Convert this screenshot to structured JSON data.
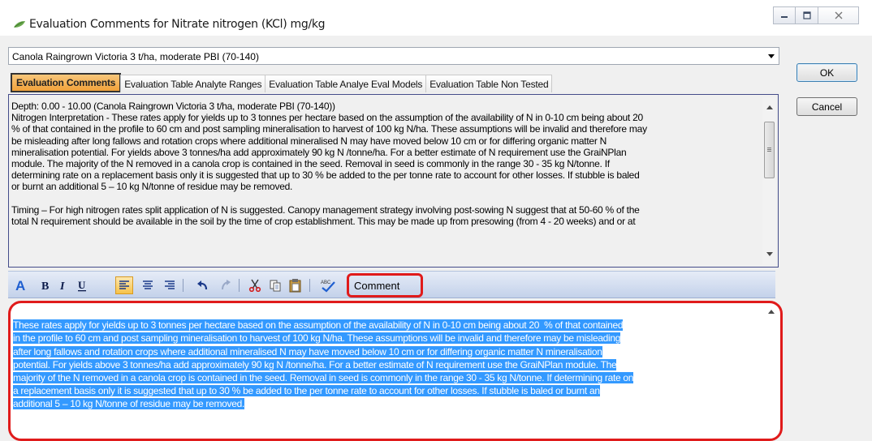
{
  "window": {
    "title": "Evaluation Comments for Nitrate nitrogen (KCl)  mg/kg",
    "icon": "plant-leaf-icon",
    "controls": {
      "minimize": "▭",
      "maximize": "▣",
      "close": "✕"
    }
  },
  "crop_select": {
    "value": "Canola Raingrown Victoria 3 t/ha, moderate PBI (70-140)"
  },
  "buttons": {
    "ok": "OK",
    "cancel": "Cancel"
  },
  "tabs": [
    {
      "label": "Evaluation Comments",
      "active": true
    },
    {
      "label": "Evaluation Table Analyte Ranges",
      "active": false
    },
    {
      "label": "Evaluation Table Analye Eval Models",
      "active": false
    },
    {
      "label": "Evaluation Table Non Tested",
      "active": false
    }
  ],
  "evaluation": {
    "text": "Depth: 0.00 - 10.00 (Canola Raingrown Victoria 3 t/ha, moderate PBI (70-140))\nNitrogen Interpretation - These rates apply for yields up to 3 tonnes per hectare based on the assumption of the availability of N in 0-10 cm being about 20\n% of that contained in the profile to 60 cm and post sampling mineralisation to harvest of 100 kg N/ha. These assumptions will be invalid and therefore may\nbe misleading after long fallows and rotation crops where additional mineralised N may have moved below 10 cm or for differing organic matter N\nmineralisation potential. For yields above 3 tonnes/ha add approximately 90 kg N /tonne/ha. For a better estimate of N requirement use the GraiNPlan\nmodule. The majority of the N removed in a canola crop is contained in the seed. Removal in seed is commonly in the range 30 - 35 kg N/tonne. If\ndetermining rate on a replacement basis only it is suggested that up to 30 % be added to the per tonne rate to account for other losses. If stubble is baled\nor burnt an additional 5 – 10 kg N/tonne of residue may be removed.\n\nTiming – For high nitrogen rates split application of N is suggested. Canopy management strategy involving post-sowing N suggest that at 50-60 % of the\ntotal N requirement should be available in the soil by the time of crop establishment. This may be made up from presowing (from 4 - 20 weeks) and or at"
  },
  "toolbar": {
    "items": [
      {
        "name": "font-color-icon",
        "glyph": "A"
      },
      {
        "name": "bold-icon",
        "glyph": "B"
      },
      {
        "name": "italic-icon",
        "glyph": "I"
      },
      {
        "name": "underline-icon",
        "glyph": "U"
      },
      {
        "name": "align-left-icon",
        "glyph": "≡"
      },
      {
        "name": "align-center-icon",
        "glyph": "≡"
      },
      {
        "name": "align-right-icon",
        "glyph": "≡"
      },
      {
        "name": "undo-icon",
        "glyph": "↶"
      },
      {
        "name": "redo-icon",
        "glyph": "↷"
      },
      {
        "name": "cut-icon",
        "glyph": "✂"
      },
      {
        "name": "copy-icon",
        "glyph": "⧉"
      },
      {
        "name": "paste-icon",
        "glyph": "📋"
      },
      {
        "name": "spellcheck-icon",
        "glyph": "✓"
      }
    ],
    "comment_label": "Comment"
  },
  "comment": {
    "lines": [
      "These rates apply for yields up to 3 tonnes per hectare based on the assumption of the availability of N in 0-10 cm being about 20  % of that contained",
      "in the profile to 60 cm and post sampling mineralisation to harvest of 100 kg N/ha. These assumptions will be invalid and therefore may be misleading",
      "after long fallows and rotation crops where additional mineralised N may have moved below 10 cm or for differing organic matter N mineralisation",
      "potential. For yields above 3 tonnes/ha add approximately 90 kg N /tonne/ha. For a better estimate of N requirement use the GraiNPlan module. The",
      "majority of the N removed in a canola crop is contained in the seed. Removal in seed is commonly in the range 30 - 35 kg N/tonne. If determining rate on",
      "a replacement basis only it is suggested that up to 30 % be added to the per tonne rate to account for other losses. If stubble is baled or burnt an",
      "additional 5 – 10 kg N/tonne of residue may be removed."
    ]
  },
  "colors": {
    "active_tab": "#f1a13a",
    "highlight": "#e01b1b",
    "selection": "#3399ff",
    "toolbar": "#c3d1ea"
  }
}
